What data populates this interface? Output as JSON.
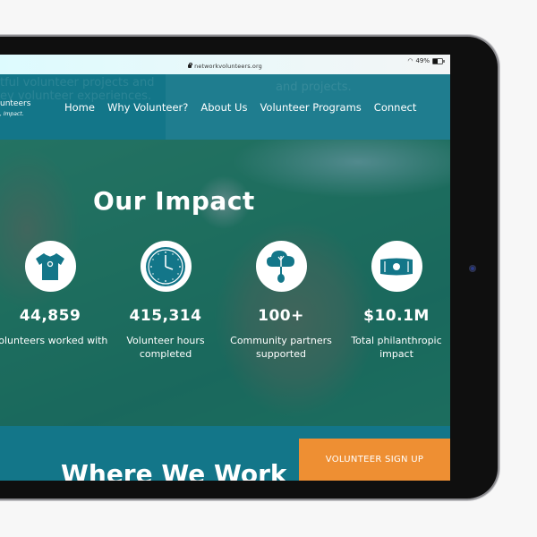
{
  "browser": {
    "url": "networkvolunteers.org",
    "battery_text": "49%",
    "battery_level": 0.49
  },
  "header": {
    "logo_line1": "unteers",
    "logo_line2": ", Impact.",
    "ghost_text_left_1": "tful volunteer projects and",
    "ghost_text_left_2": "ey volunteer experiences.",
    "ghost_text_right": "and projects.",
    "nav": [
      {
        "label": "Home"
      },
      {
        "label": "Why Volunteer?"
      },
      {
        "label": "About Us"
      },
      {
        "label": "Volunteer Programs"
      },
      {
        "label": "Connect"
      }
    ]
  },
  "impact": {
    "title": "Our Impact",
    "stats": [
      {
        "icon": "tshirt-icon",
        "value": "44,859",
        "label": "Volunteers worked with"
      },
      {
        "icon": "clock-icon",
        "value": "415,314",
        "label": "Volunteer hours completed"
      },
      {
        "icon": "tree-cloud-icon",
        "value": "100+",
        "label": "Community partners supported"
      },
      {
        "icon": "money-bill-icon",
        "value": "$10.1M",
        "label": "Total philanthropic impact"
      }
    ]
  },
  "bottom": {
    "heading": "Where We Work",
    "signup_label": "VOLUNTEER SIGN UP"
  },
  "colors": {
    "brand_teal": "#137689",
    "accent_orange": "#ee8f33"
  }
}
